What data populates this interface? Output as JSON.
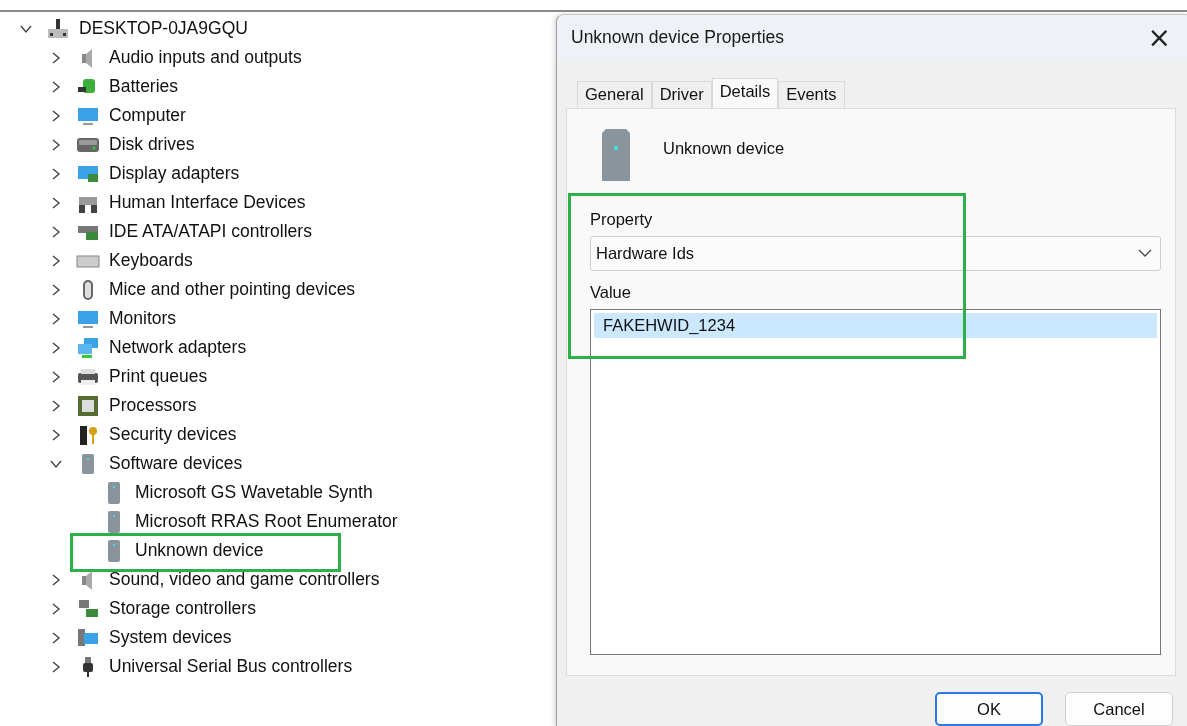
{
  "tree": {
    "label": "DESKTOP-0JA9GQU",
    "expanded": true,
    "children": [
      {
        "label": "Audio inputs and outputs",
        "expanded": false
      },
      {
        "label": "Batteries",
        "expanded": false
      },
      {
        "label": "Computer",
        "expanded": false
      },
      {
        "label": "Disk drives",
        "expanded": false
      },
      {
        "label": "Display adapters",
        "expanded": false
      },
      {
        "label": "Human Interface Devices",
        "expanded": false
      },
      {
        "label": "IDE ATA/ATAPI controllers",
        "expanded": false
      },
      {
        "label": "Keyboards",
        "expanded": false
      },
      {
        "label": "Mice and other pointing devices",
        "expanded": false
      },
      {
        "label": "Monitors",
        "expanded": false
      },
      {
        "label": "Network adapters",
        "expanded": false
      },
      {
        "label": "Print queues",
        "expanded": false
      },
      {
        "label": "Processors",
        "expanded": false
      },
      {
        "label": "Security devices",
        "expanded": false
      },
      {
        "label": "Software devices",
        "expanded": true,
        "children": [
          {
            "label": "Microsoft GS Wavetable Synth",
            "highlighted": false
          },
          {
            "label": "Microsoft RRAS Root Enumerator",
            "highlighted": false
          },
          {
            "label": "Unknown device",
            "highlighted": true
          }
        ]
      },
      {
        "label": "Sound, video and game controllers",
        "expanded": false
      },
      {
        "label": "Storage controllers",
        "expanded": false
      },
      {
        "label": "System devices",
        "expanded": false
      },
      {
        "label": "Universal Serial Bus controllers",
        "expanded": false
      }
    ]
  },
  "dialog": {
    "title": "Unknown device Properties",
    "close": "×",
    "tabs": [
      {
        "label": "General",
        "selected": false
      },
      {
        "label": "Driver",
        "selected": false
      },
      {
        "label": "Details",
        "selected": true
      },
      {
        "label": "Events",
        "selected": false
      }
    ],
    "device_name": "Unknown device",
    "highlighted": true,
    "property": {
      "label": "Property",
      "value": "Hardware Ids"
    },
    "value_list": {
      "label": "Value",
      "items": [
        {
          "text": "FAKEHWID_1234",
          "selected": true
        }
      ]
    },
    "buttons": [
      {
        "label": "OK",
        "default": true
      },
      {
        "label": "Cancel",
        "default": false
      }
    ]
  }
}
